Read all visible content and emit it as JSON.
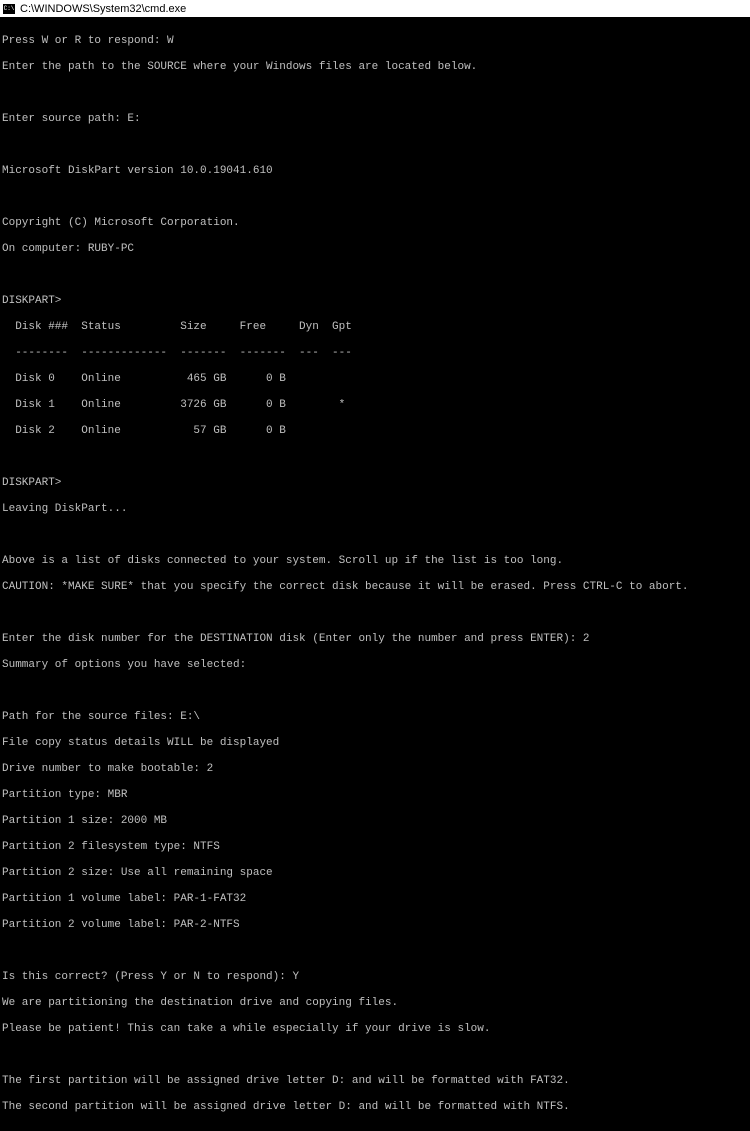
{
  "titlebar": {
    "text": "C:\\WINDOWS\\System32\\cmd.exe"
  },
  "lines": {
    "l1": "Press W or R to respond: W",
    "l2": "Enter the path to the SOURCE where your Windows files are located below.",
    "l3": "",
    "l4": "Enter source path: E:",
    "l5": "",
    "l6": "Microsoft DiskPart version 10.0.19041.610",
    "l7": "",
    "l8": "Copyright (C) Microsoft Corporation.",
    "l9": "On computer: RUBY-PC",
    "l10": "",
    "l11": "DISKPART>",
    "l12": "  Disk ###  Status         Size     Free     Dyn  Gpt",
    "l13": "  --------  -------------  -------  -------  ---  ---",
    "l14": "  Disk 0    Online          465 GB      0 B",
    "l15": "  Disk 1    Online         3726 GB      0 B        *",
    "l16": "  Disk 2    Online           57 GB      0 B",
    "l17": "",
    "l18": "DISKPART>",
    "l19": "Leaving DiskPart...",
    "l20": "",
    "l21": "Above is a list of disks connected to your system. Scroll up if the list is too long.",
    "l22": "CAUTION: *MAKE SURE* that you specify the correct disk because it will be erased. Press CTRL-C to abort.",
    "l23": "",
    "l24": "Enter the disk number for the DESTINATION disk (Enter only the number and press ENTER): 2",
    "l25": "Summary of options you have selected:",
    "l26": "",
    "l27": "Path for the source files: E:\\",
    "l28": "File copy status details WILL be displayed",
    "l29": "Drive number to make bootable: 2",
    "l30": "Partition type: MBR",
    "l31": "Partition 1 size: 2000 MB",
    "l32": "Partition 2 filesystem type: NTFS",
    "l33": "Partition 2 size: Use all remaining space",
    "l34": "Partition 1 volume label: PAR-1-FAT32",
    "l35": "Partition 2 volume label: PAR-2-NTFS",
    "l36": "",
    "l37": "Is this correct? (Press Y or N to respond): Y",
    "l38": "We are partitioning the destination drive and copying files.",
    "l39": "Please be patient! This can take a while especially if your drive is slow.",
    "l40": "",
    "l41": "The first partition will be assigned drive letter D: and will be formatted with FAT32.",
    "l42": "The second partition will be assigned drive letter D: and will be formatted with NTFS."
  }
}
